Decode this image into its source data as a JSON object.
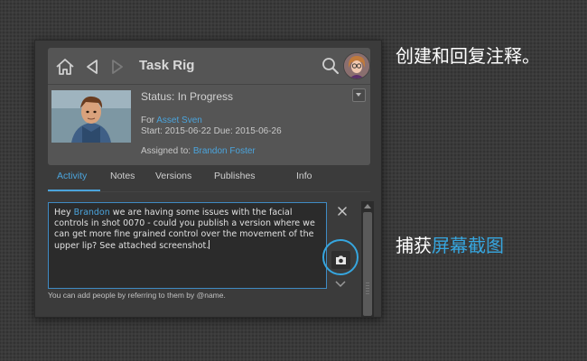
{
  "panel": {
    "title": "Task Rig",
    "status": "Status: In Progress",
    "for_prefix": "For ",
    "for_link": "Asset Sven",
    "dates": "Start: 2015-06-22 Due: 2015-06-26",
    "assigned_prefix": "Assigned to: ",
    "assigned_link": "Brandon Foster",
    "tabs": [
      {
        "label": "Activity",
        "active": true
      },
      {
        "label": "Notes"
      },
      {
        "label": "Versions"
      },
      {
        "label": "Publishes"
      },
      {
        "label": "Info"
      }
    ],
    "note": {
      "prefix": "Hey ",
      "mention": "Brandon",
      "body": " we are having some issues with the facial controls in shot 0070 - could you publish a version where we can get more fine grained control over the movement of the upper lip? See attached screenshot."
    },
    "hint": "You can add people by referring to them by @name.",
    "icons": [
      "home-icon",
      "back-arrow-icon",
      "forward-arrow-icon",
      "search-icon",
      "close-icon",
      "camera-icon",
      "chevron-down-icon"
    ],
    "accent_color": "#4ba4dc"
  },
  "captions": {
    "top": "创建和回复注释。",
    "bottom_prefix": "捕获",
    "bottom_highlight": "屏幕截图"
  }
}
